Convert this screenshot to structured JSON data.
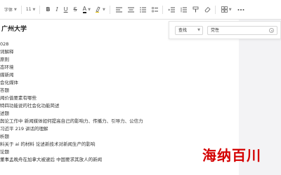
{
  "toolbar": {
    "font_family": "字体",
    "font_size": "11",
    "bold": "B",
    "italic": "I",
    "underline": "U",
    "strikethrough": "S",
    "font_color": "A",
    "highlight": "A"
  },
  "document": {
    "title": "广州大学",
    "lines": [
      "028",
      "词解释",
      "原则",
      "态环境",
      "媒新闻",
      "会化媒体",
      "答题",
      "闻价值要素有哪些",
      "特四功能说的社会化功能简述",
      "述题",
      "舆论工作中 新闻媒体如何提高自己的影响力、传播力、引导力、公信力",
      "习近平 219 讲话的理解",
      "析题",
      "料关于 ai 的材料 论述新技术对新闻生产的影响",
      "论题",
      "董事孟晚舟在加拿大被逮后 中国要求其放人的新闻"
    ]
  },
  "find_panel": {
    "mode": "查找",
    "query": "党性"
  },
  "watermark": "海纳百川"
}
